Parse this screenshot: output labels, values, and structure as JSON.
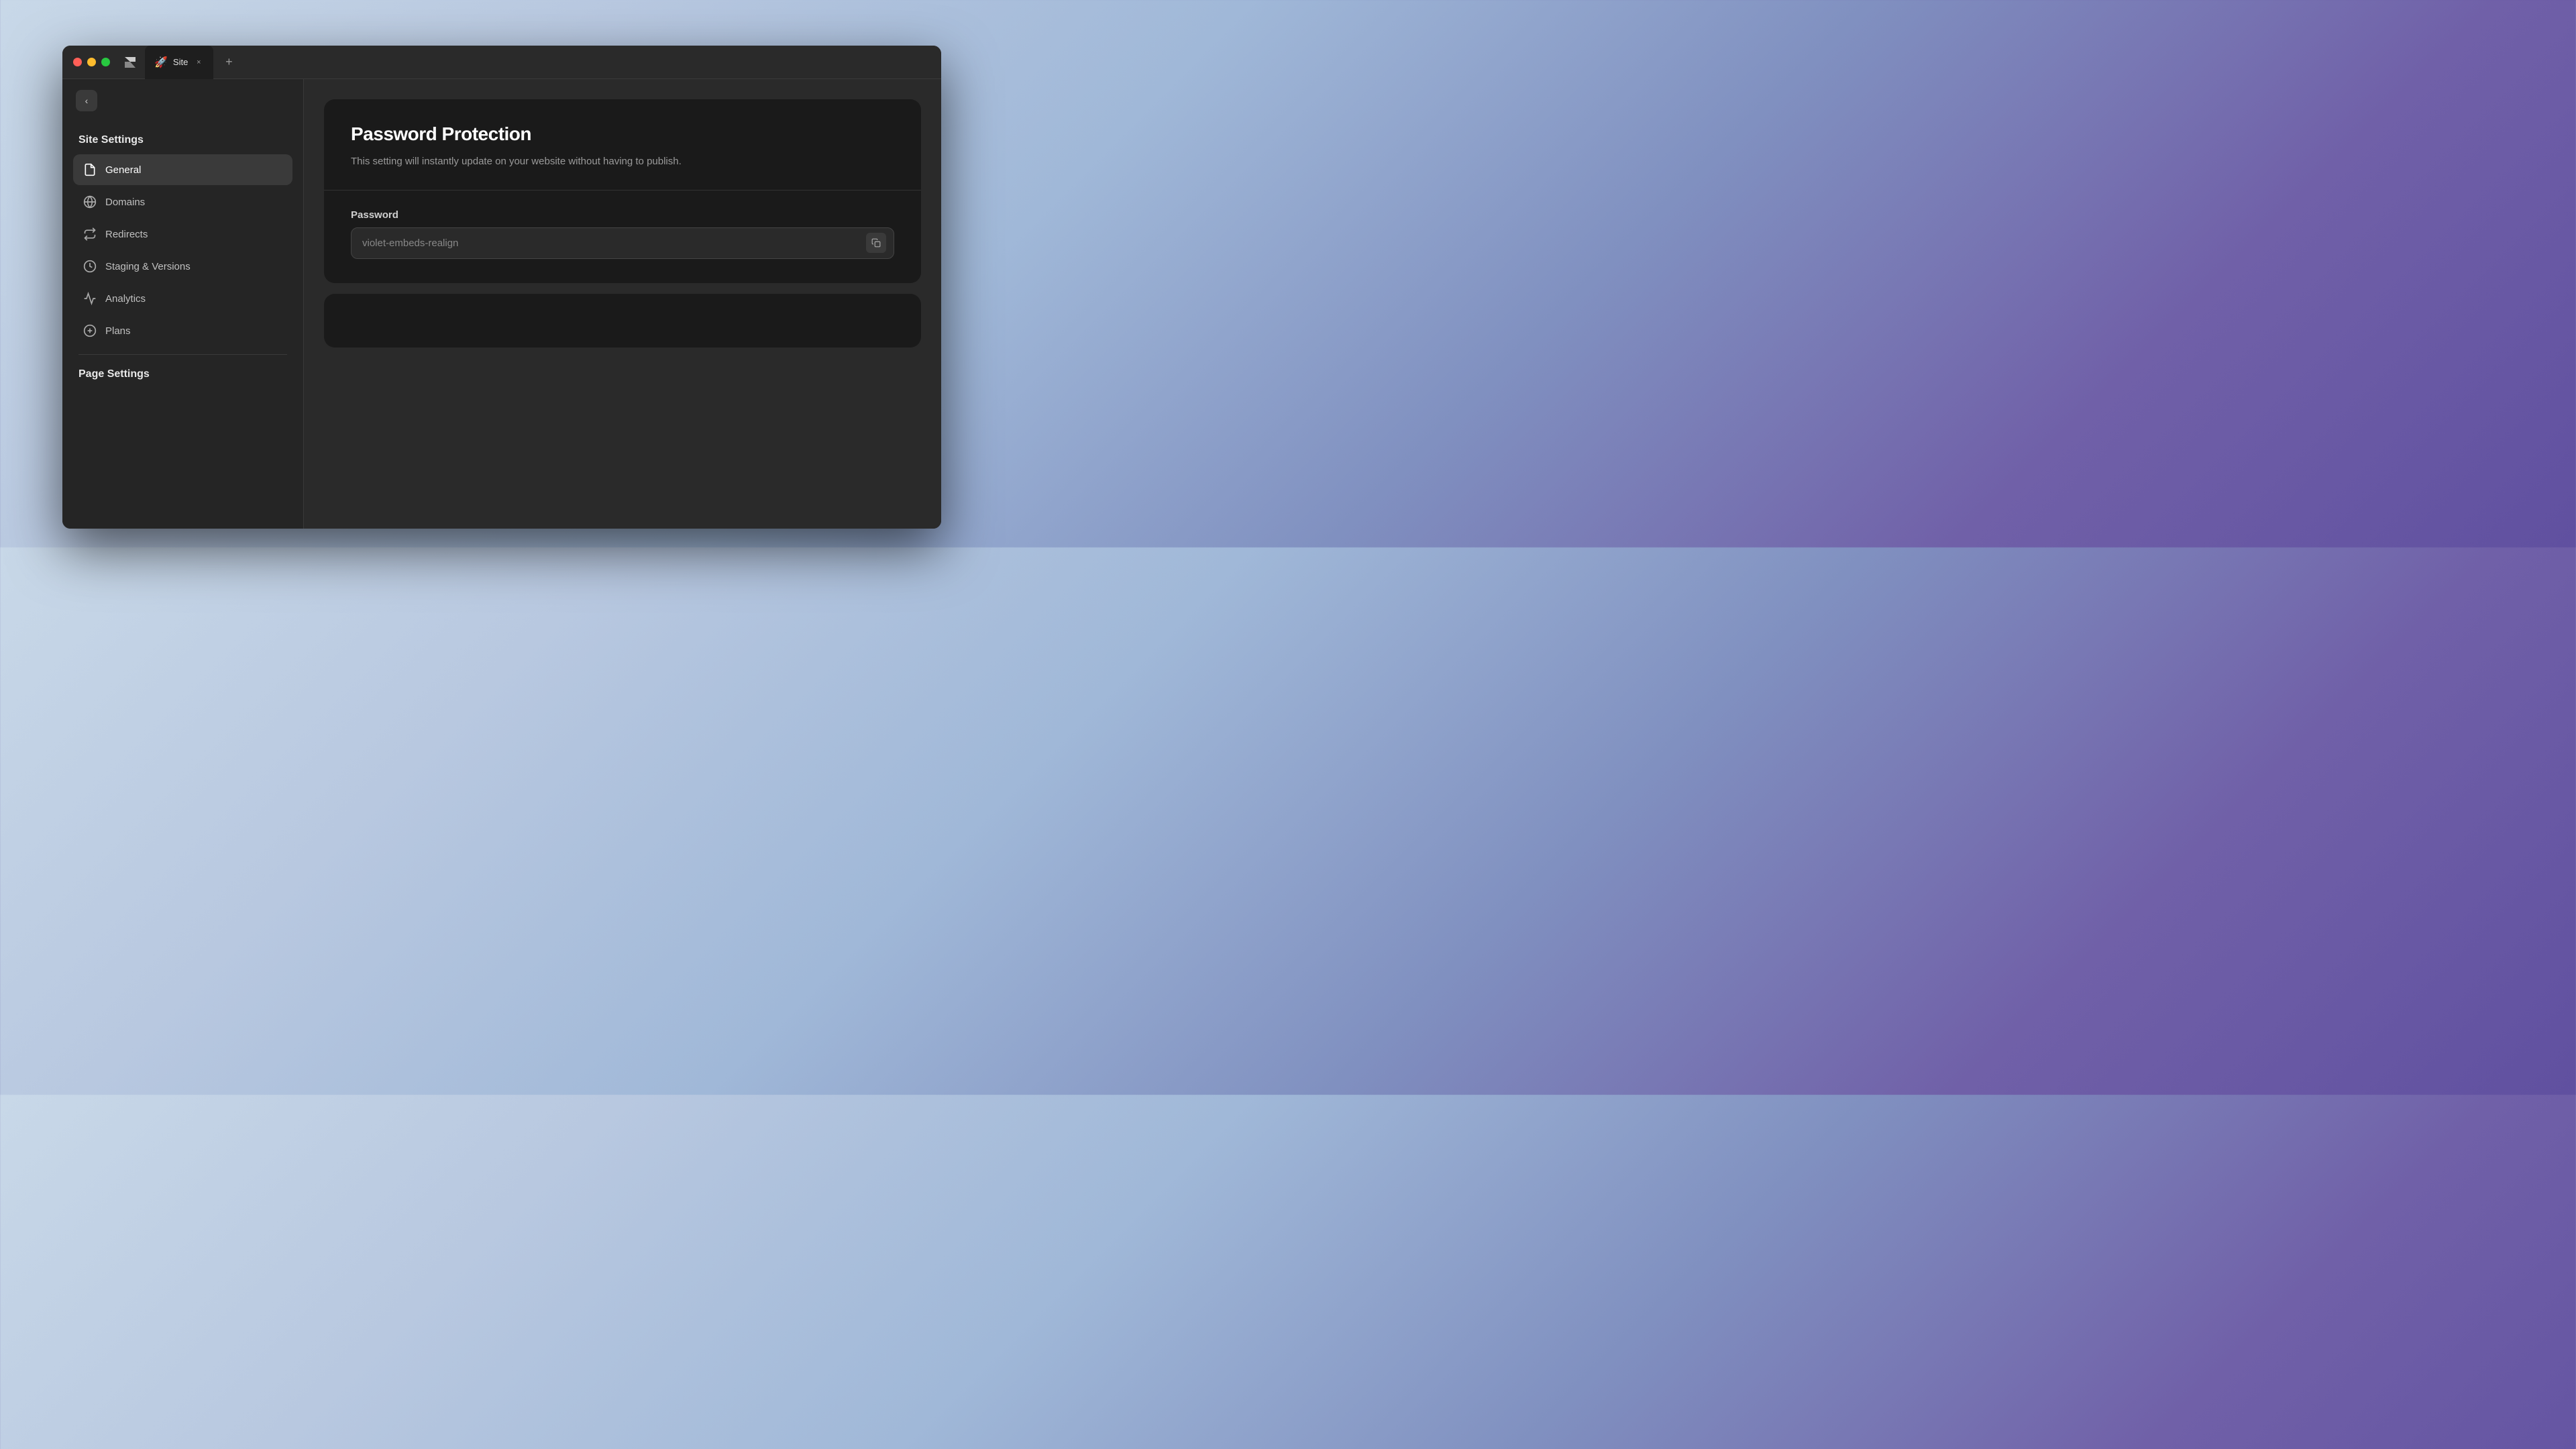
{
  "browser": {
    "tab_title": "Site",
    "tab_favicon": "🚀",
    "close_label": "×",
    "new_tab_label": "+",
    "back_label": "‹"
  },
  "sidebar": {
    "section_title": "Site Settings",
    "nav_items": [
      {
        "id": "general",
        "label": "General",
        "icon": "file",
        "active": true
      },
      {
        "id": "domains",
        "label": "Domains",
        "icon": "globe"
      },
      {
        "id": "redirects",
        "label": "Redirects",
        "icon": "redirect"
      },
      {
        "id": "staging",
        "label": "Staging & Versions",
        "icon": "clock"
      },
      {
        "id": "analytics",
        "label": "Analytics",
        "icon": "analytics"
      },
      {
        "id": "plans",
        "label": "Plans",
        "icon": "dollar"
      }
    ],
    "page_settings_title": "Page Settings"
  },
  "content": {
    "card": {
      "title": "Password Protection",
      "description": "This setting will instantly update on your website without having to publish.",
      "password_label": "Password",
      "password_value": "violet-embeds-realign"
    }
  }
}
